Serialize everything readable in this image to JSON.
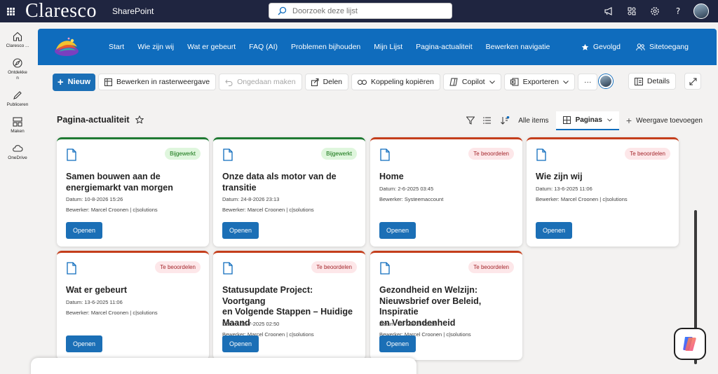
{
  "suite": {
    "brand": "Claresco",
    "app_name": "SharePoint",
    "search_placeholder": "Doorzoek deze lijst"
  },
  "rail": [
    {
      "label": "Claresco ...",
      "icon": "home-icon"
    },
    {
      "label": "Ontdekken",
      "icon": "discover-icon"
    },
    {
      "label": "Publiceren",
      "icon": "pen-icon"
    },
    {
      "label": "Maken",
      "icon": "create-icon"
    },
    {
      "label": "OneDrive",
      "icon": "cloud-icon"
    }
  ],
  "site_nav": {
    "items": [
      "Start",
      "Wie zijn wij",
      "Wat er gebeurt",
      "FAQ (AI)",
      "Problemen bijhouden",
      "Mijn Lijst",
      "Pagina-actualiteit"
    ],
    "edit_nav": "Bewerken navigatie",
    "followed": "Gevolgd",
    "site_access": "Sitetoegang"
  },
  "command_bar": {
    "new": "Nieuw",
    "grid_edit": "Bewerken in rasterweergave",
    "undo": "Ongedaan maken",
    "share": "Delen",
    "copy_link": "Koppeling kopiëren",
    "copilot": "Copilot",
    "export": "Exporteren",
    "more": "···",
    "details": "Details"
  },
  "list": {
    "title": "Pagina-actualiteit",
    "all_items": "Alle items",
    "current_view": "Paginas",
    "add_view": "Weergave toevoegen"
  },
  "cards": [
    {
      "title_lines": [
        "Samen bouwen aan de",
        "energiemarkt van morgen"
      ],
      "badge": "Bijgewerkt",
      "status": "ok",
      "date": "Datum: 10-8-2026 15:26",
      "editor": "Bewerker: Marcel Croonen | c|solutions",
      "button": "Openen"
    },
    {
      "title_lines": [
        "Onze data als motor van de",
        "transitie"
      ],
      "badge": "Bijgewerkt",
      "status": "ok",
      "date": "Datum: 24-8-2026 23:13",
      "editor": "Bewerker: Marcel Croonen | c|solutions",
      "button": "Openen"
    },
    {
      "title_lines": [
        "Home"
      ],
      "badge": "Te beoordelen",
      "status": "warn",
      "date": "Datum: 2-6-2025 03:45",
      "editor": "Bewerker: Systeemaccount",
      "button": "Openen"
    },
    {
      "title_lines": [
        "Wie zijn wij"
      ],
      "badge": "Te beoordelen",
      "status": "warn",
      "date": "Datum: 13-6-2025 11:06",
      "editor": "Bewerker: Marcel Croonen | c|solutions",
      "button": "Openen"
    },
    {
      "title_lines": [
        "Wat er gebeurt"
      ],
      "badge": "Te beoordelen",
      "status": "warn",
      "date": "Datum: 13-6-2025 11:06",
      "editor": "Bewerker: Marcel Croonen | c|solutions",
      "button": "Openen"
    },
    {
      "title_lines": [
        "Statusupdate Project: Voortgang",
        "en Volgende Stappen – Huidige",
        "Maand"
      ],
      "badge": "Te beoordelen",
      "status": "warn",
      "date": "Datum: 18-7-2025 02:50",
      "editor": "Bewerker: Marcel Croonen | c|solutions",
      "button": "Openen"
    },
    {
      "title_lines": [
        "Gezondheid en Welzijn:",
        "Nieuwsbrief over Beleid, Inspiratie",
        "en Verbondenheid"
      ],
      "badge": "Te beoordelen",
      "status": "warn",
      "date": "Datum: 19-7-2025 09:58",
      "editor": "Bewerker: Marcel Croonen | c|solutions",
      "button": "Openen"
    }
  ],
  "colors": {
    "suite_bg": "#1f2540",
    "site_header": "#0f6cbd",
    "primary_button": "#1b6fb6",
    "status_ok_border": "#1f7a33",
    "status_warn_border": "#c43e1c"
  }
}
